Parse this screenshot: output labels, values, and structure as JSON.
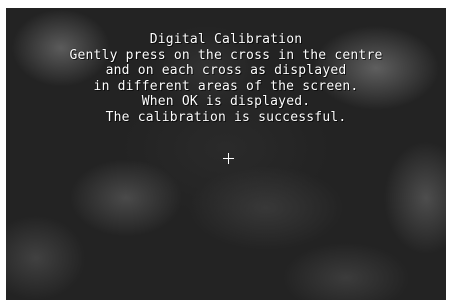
{
  "calibration": {
    "title": "Digital Calibration",
    "instructions": [
      "Gently press on the cross in the centre",
      "and on each cross as displayed",
      "in different areas of the screen.",
      "When OK is displayed.",
      "The calibration is successful."
    ],
    "target_icon": "crosshair-icon",
    "text_color": "#ffffff",
    "background_color": "#232323"
  }
}
